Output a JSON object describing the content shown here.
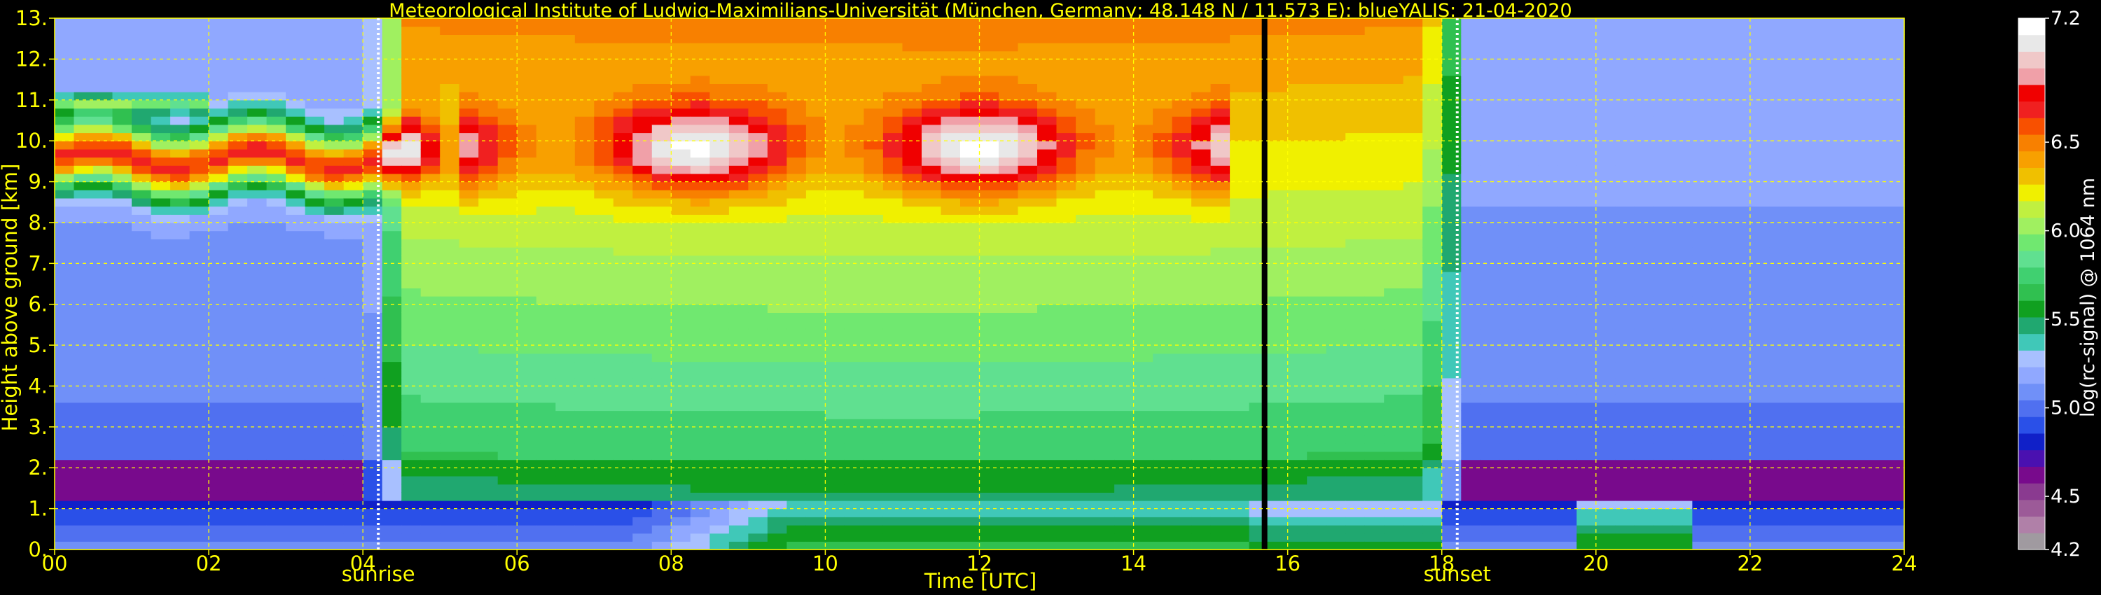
{
  "chart_data": {
    "type": "heatmap",
    "title": "Meteorological Institute of Ludwig-Maximilians-Universität (München, Germany; 48.148 N / 11.573 E):    blueYALIS: 21-04-2020",
    "xlabel": "Time [UTC]",
    "ylabel": "Height above ground [km]",
    "xlim": [
      0,
      24
    ],
    "ylim": [
      0,
      13
    ],
    "x_ticks": [
      {
        "value": 0,
        "label": "00"
      },
      {
        "value": 2,
        "label": "02"
      },
      {
        "value": 4,
        "label": "04"
      },
      {
        "value": 6,
        "label": "06"
      },
      {
        "value": 8,
        "label": "08"
      },
      {
        "value": 10,
        "label": "10"
      },
      {
        "value": 12,
        "label": "12"
      },
      {
        "value": 14,
        "label": "14"
      },
      {
        "value": 16,
        "label": "16"
      },
      {
        "value": 18,
        "label": "18"
      },
      {
        "value": 20,
        "label": "20"
      },
      {
        "value": 22,
        "label": "22"
      },
      {
        "value": 24,
        "label": "24"
      }
    ],
    "y_ticks": [
      {
        "value": 0,
        "label": "0."
      },
      {
        "value": 1,
        "label": "1."
      },
      {
        "value": 2,
        "label": "2."
      },
      {
        "value": 3,
        "label": "3."
      },
      {
        "value": 4,
        "label": "4."
      },
      {
        "value": 5,
        "label": "5."
      },
      {
        "value": 6,
        "label": "6."
      },
      {
        "value": 7,
        "label": "7."
      },
      {
        "value": 8,
        "label": "8."
      },
      {
        "value": 9,
        "label": "9."
      },
      {
        "value": 10,
        "label": "10."
      },
      {
        "value": 11,
        "label": "11."
      },
      {
        "value": 12,
        "label": "12."
      },
      {
        "value": 13,
        "label": "13."
      }
    ],
    "grid": true,
    "annotations": [
      {
        "x": 4.2,
        "label": "sunrise"
      },
      {
        "x": 18.2,
        "label": "sunset"
      }
    ],
    "data_gap_x": 15.7,
    "colorbar": {
      "label": "log(rc-signal) @ 1064 nm",
      "vmin": 4.2,
      "vmax": 7.2,
      "ticks": [
        {
          "value": 7.2,
          "label": "7.2"
        },
        {
          "value": 6.5,
          "label": "6.5"
        },
        {
          "value": 6.0,
          "label": "6.0"
        },
        {
          "value": 5.5,
          "label": "5.5"
        },
        {
          "value": 5.0,
          "label": "5.0"
        },
        {
          "value": 4.5,
          "label": "4.5"
        },
        {
          "value": 4.2,
          "label": "4.2"
        }
      ],
      "colors_low_to_high": [
        "#a09aa0",
        "#b080a8",
        "#9c5a98",
        "#8a3a90",
        "#780a8c",
        "#4a10b0",
        "#1020c8",
        "#2a50e8",
        "#5070f0",
        "#7090f8",
        "#90a8ff",
        "#a8c0ff",
        "#40c8b8",
        "#20a870",
        "#10a020",
        "#30c050",
        "#40d070",
        "#60e090",
        "#70e870",
        "#a0f060",
        "#c0f040",
        "#f0f000",
        "#f0c000",
        "#f8a000",
        "#f88000",
        "#f85000",
        "#f02020",
        "#f00000",
        "#f0a0a8",
        "#f0c8c8",
        "#e8e8e8",
        "#ffffff"
      ]
    },
    "features": [
      {
        "name": "boundary layer",
        "x_range": [
          0,
          24
        ],
        "height_range": [
          0,
          1.2
        ]
      },
      {
        "name": "cirrus",
        "x_range": [
          0,
          5.3
        ],
        "height_range": [
          8.1,
          10.9
        ]
      },
      {
        "name": "cirrus",
        "x_range": [
          5.3,
          15.2
        ],
        "height_range": [
          8.9,
          11.3
        ]
      }
    ]
  }
}
